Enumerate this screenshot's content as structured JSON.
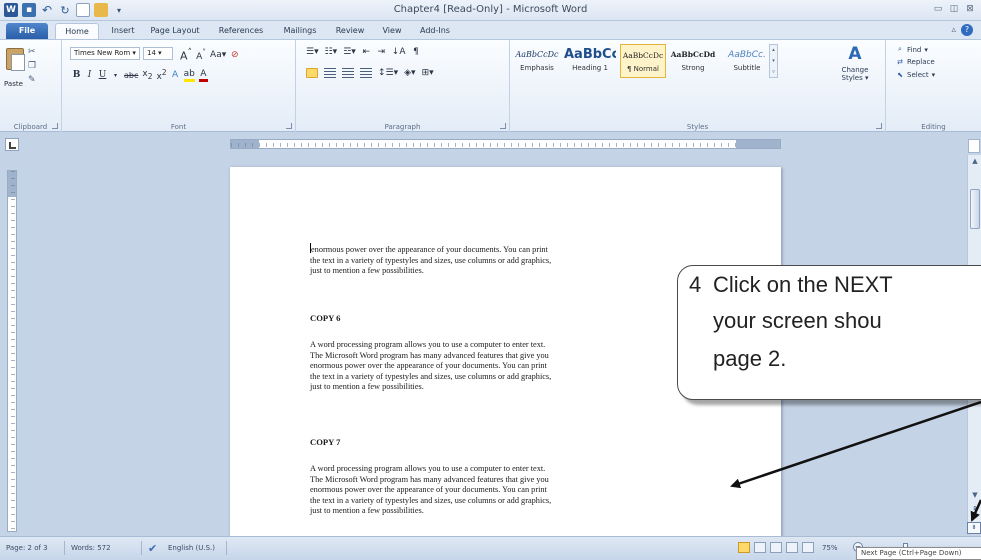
{
  "window": {
    "title": "Chapter4 [Read-Only] - Microsoft Word",
    "controls": [
      "minimize",
      "restore",
      "close"
    ]
  },
  "ribbon_tabs": [
    "File",
    "Home",
    "Insert",
    "Page Layout",
    "References",
    "Mailings",
    "Review",
    "View",
    "Add-Ins"
  ],
  "active_tab": "Home",
  "clipboard": {
    "paste_label": "Paste",
    "group_label": "Clipboard"
  },
  "font": {
    "name": "Times New Rom",
    "size": "14",
    "group_label": "Font"
  },
  "paragraph": {
    "group_label": "Paragraph"
  },
  "styles": {
    "group_label": "Styles",
    "items": [
      {
        "sample": "AaBbCcDc",
        "name": "Emphasis"
      },
      {
        "sample": "AaBbCc",
        "name": "Heading 1"
      },
      {
        "sample": "AaBbCcDc",
        "name": "¶ Normal"
      },
      {
        "sample": "AaBbCcDd",
        "name": "Strong"
      },
      {
        "sample": "AaBbCc.",
        "name": "Subtitle"
      }
    ],
    "selected_index": 2,
    "change_styles_label": "Change Styles"
  },
  "editing": {
    "group_label": "Editing",
    "find": "Find",
    "replace": "Replace",
    "select": "Select"
  },
  "document": {
    "paragraphs": [
      {
        "kind": "text",
        "text": "enormous power over the appearance of your documents.  You can print\nthe text in a variety of typestyles and sizes, use columns or add graphics,\njust to mention a few possibilities."
      },
      {
        "kind": "heading",
        "text": "COPY 6"
      },
      {
        "kind": "text",
        "text": "A word processing program allows you to use a computer to enter text.\nThe Microsoft Word program has many advanced features that give you\nenormous power over the appearance of your documents.  You can print\nthe text in a variety of typestyles and sizes, use columns or add graphics,\njust to mention a few possibilities."
      },
      {
        "kind": "heading",
        "text": "COPY 7"
      },
      {
        "kind": "text",
        "text": "A word processing program allows you to use a computer to enter text.\nThe Microsoft Word program has many advanced features that give you\nenormous power over the appearance of your documents.  You can print\nthe text in a variety of typestyles and sizes, use columns or add graphics,\njust to mention a few possibilities."
      }
    ]
  },
  "callout": {
    "number": "4",
    "line1": "Click on the NEXT",
    "line2": "your screen shou",
    "line3": "page 2."
  },
  "status_bar": {
    "page": "Page: 2 of 3",
    "words": "Words: 572",
    "language": "English (U.S.)",
    "zoom": "75%"
  },
  "tooltip": "Next Page (Ctrl+Page Down)",
  "colors": {
    "ribbon_accent": "#2b5797",
    "file_tab": "#2a5ea8",
    "highlight": "#ffd86a"
  }
}
